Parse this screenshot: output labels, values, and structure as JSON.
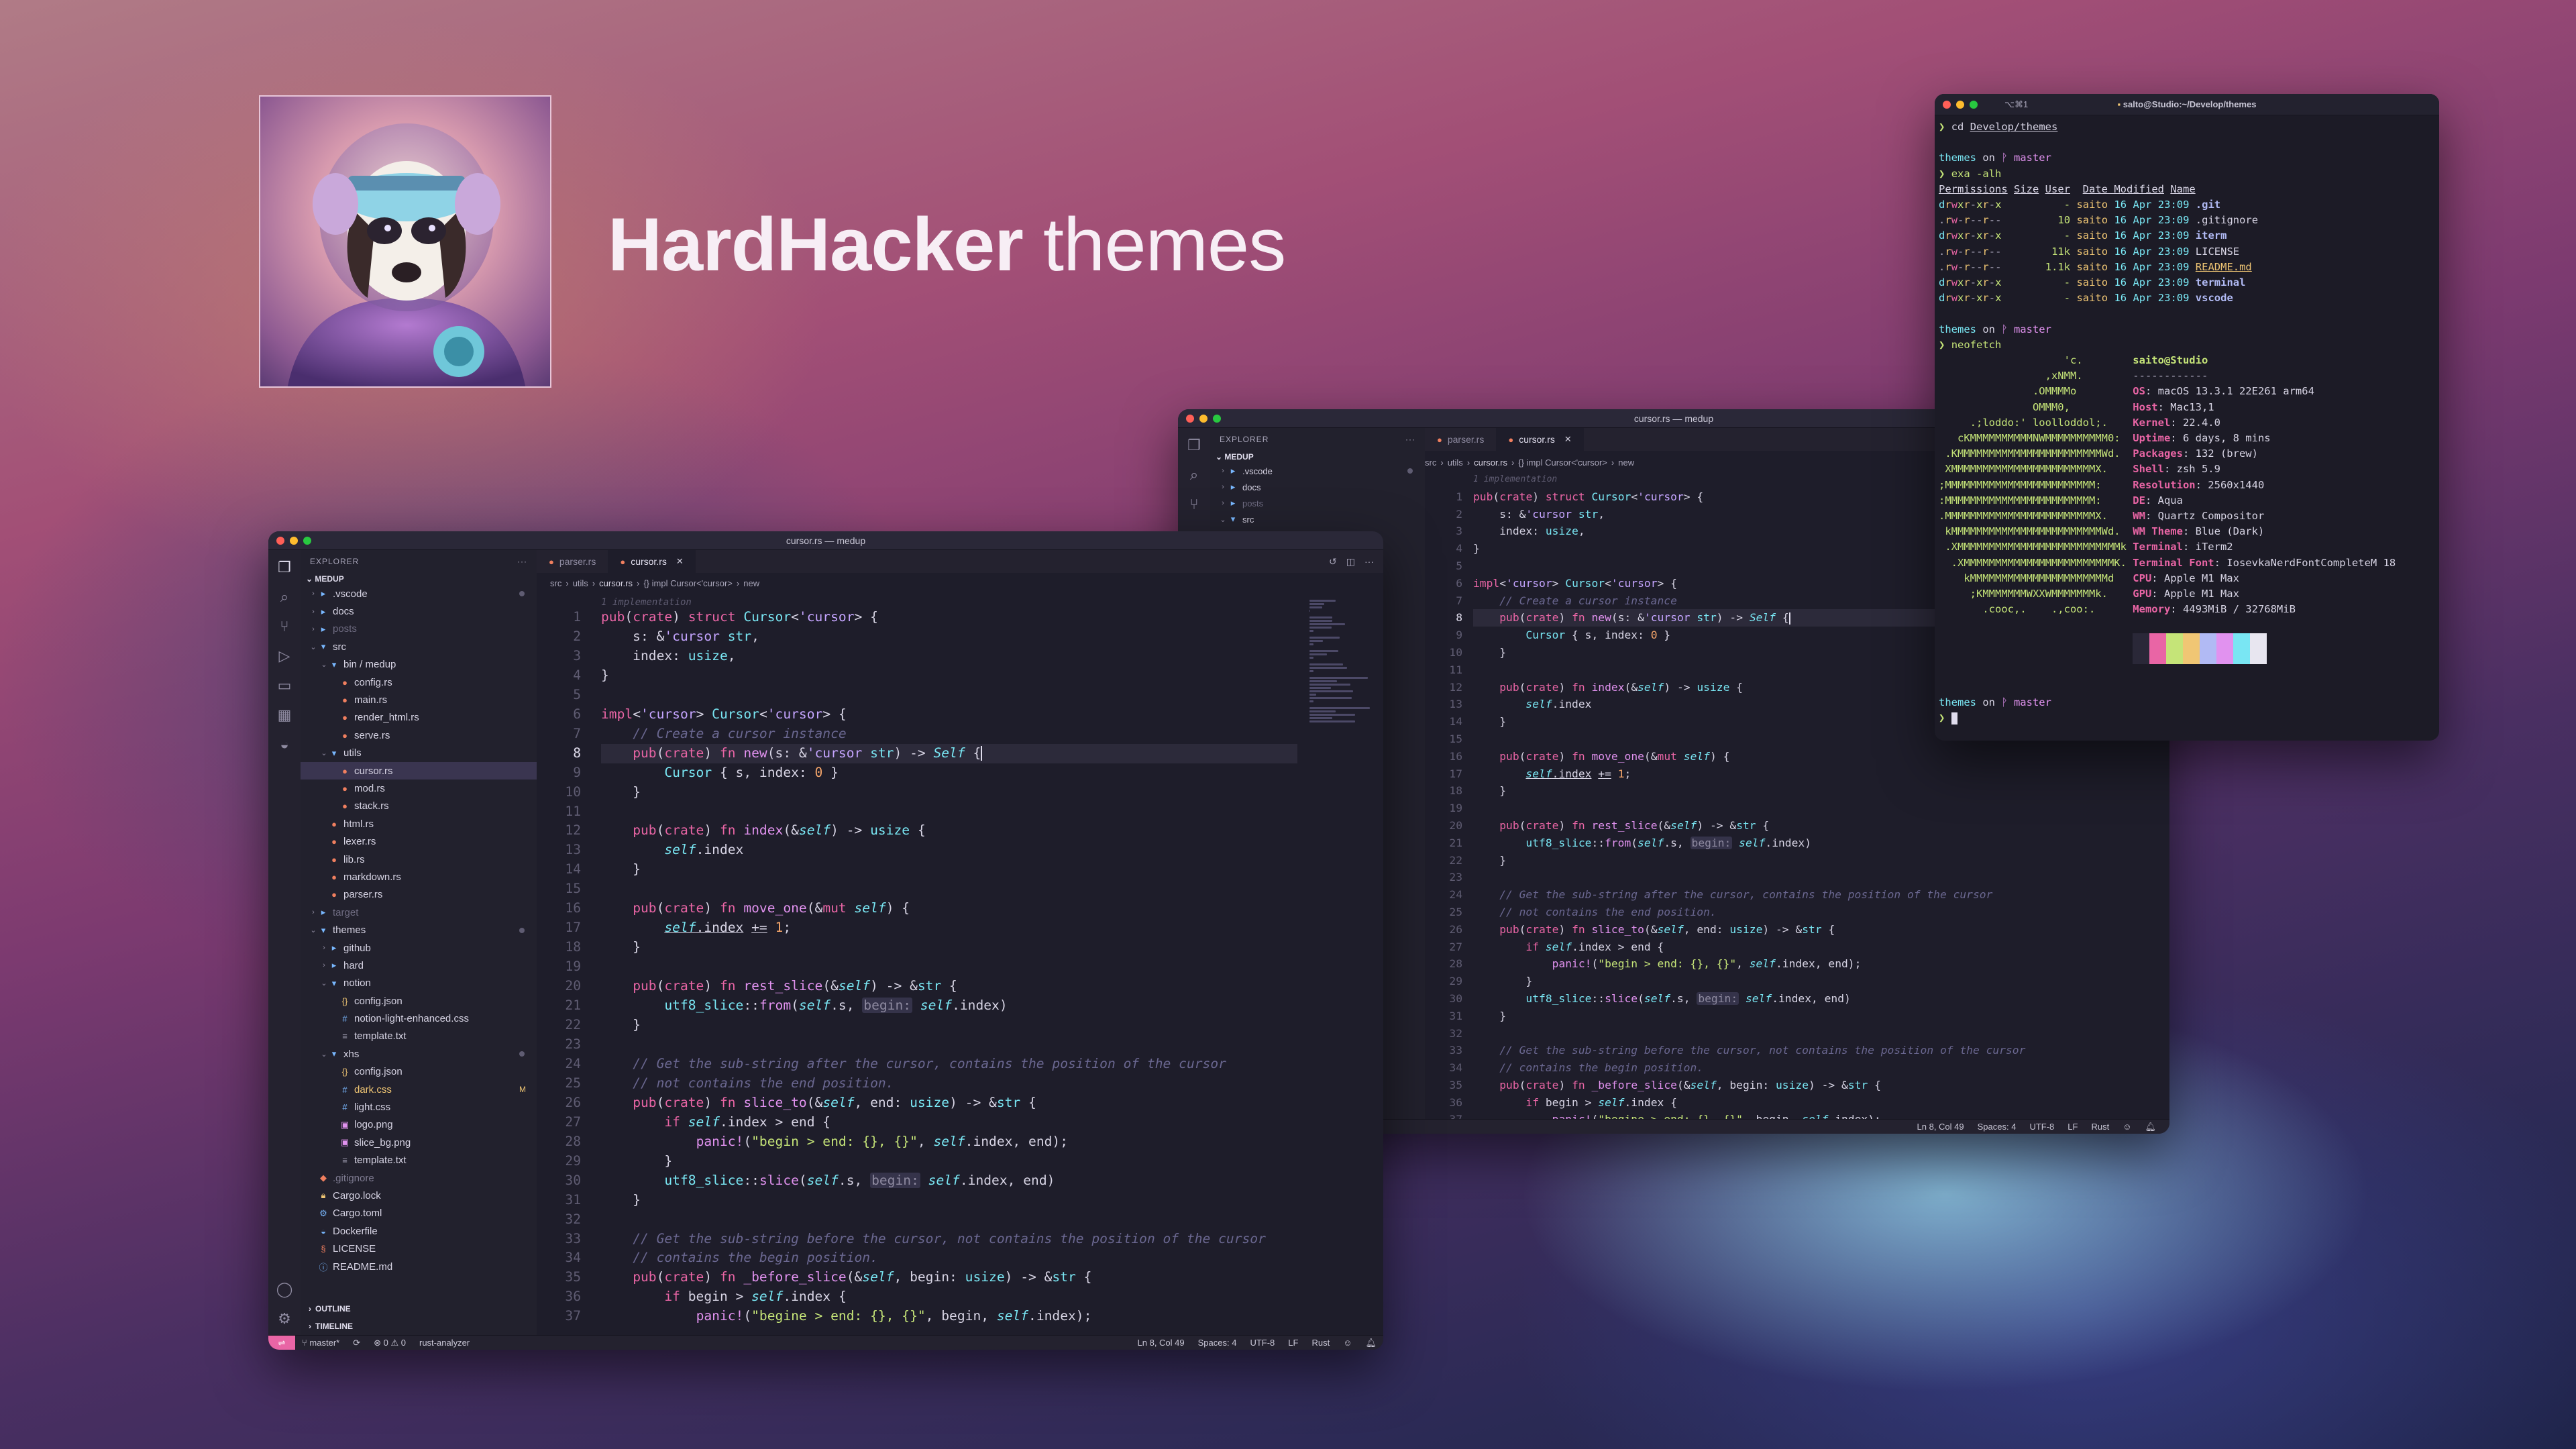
{
  "hero": {
    "title_bold": "HardHacker",
    "title_rest": " themes"
  },
  "editor_main": {
    "window_title": "cursor.rs — medup",
    "explorer_label": "EXPLORER",
    "root_label": "MEDUP",
    "tree": [
      {
        "depth": 0,
        "type": "folder",
        "open": false,
        "name": ".vscode",
        "badge": "dot"
      },
      {
        "depth": 0,
        "type": "folder",
        "open": false,
        "name": "docs"
      },
      {
        "depth": 0,
        "type": "folder",
        "open": false,
        "name": "posts",
        "dim": true
      },
      {
        "depth": 0,
        "type": "folder",
        "open": true,
        "name": "src"
      },
      {
        "depth": 1,
        "type": "folder",
        "open": true,
        "name": "bin / medup"
      },
      {
        "depth": 2,
        "type": "rust",
        "name": "config.rs"
      },
      {
        "depth": 2,
        "type": "rust",
        "name": "main.rs"
      },
      {
        "depth": 2,
        "type": "rust",
        "name": "render_html.rs"
      },
      {
        "depth": 2,
        "type": "rust",
        "name": "serve.rs"
      },
      {
        "depth": 1,
        "type": "folder",
        "open": true,
        "name": "utils"
      },
      {
        "depth": 2,
        "type": "rust",
        "name": "cursor.rs",
        "selected": true
      },
      {
        "depth": 2,
        "type": "rust",
        "name": "mod.rs"
      },
      {
        "depth": 2,
        "type": "rust",
        "name": "stack.rs"
      },
      {
        "depth": 1,
        "type": "rust",
        "name": "html.rs"
      },
      {
        "depth": 1,
        "type": "rust",
        "name": "lexer.rs"
      },
      {
        "depth": 1,
        "type": "rust",
        "name": "lib.rs"
      },
      {
        "depth": 1,
        "type": "rust",
        "name": "markdown.rs"
      },
      {
        "depth": 1,
        "type": "rust",
        "name": "parser.rs"
      },
      {
        "depth": 0,
        "type": "folder",
        "open": false,
        "name": "target",
        "dim": true
      },
      {
        "depth": 0,
        "type": "folder",
        "open": true,
        "name": "themes",
        "badge": "dot"
      },
      {
        "depth": 1,
        "type": "folder",
        "open": false,
        "name": "github"
      },
      {
        "depth": 1,
        "type": "folder",
        "open": false,
        "name": "hard"
      },
      {
        "depth": 1,
        "type": "folder",
        "open": true,
        "name": "notion"
      },
      {
        "depth": 2,
        "type": "json",
        "name": "config.json"
      },
      {
        "depth": 2,
        "type": "css",
        "name": "notion-light-enhanced.css"
      },
      {
        "depth": 2,
        "type": "txt",
        "name": "template.txt"
      },
      {
        "depth": 1,
        "type": "folder",
        "open": true,
        "name": "xhs",
        "badge": "dot"
      },
      {
        "depth": 2,
        "type": "json",
        "name": "config.json"
      },
      {
        "depth": 2,
        "type": "css",
        "name": "dark.css",
        "modified": true,
        "badge": "M"
      },
      {
        "depth": 2,
        "type": "css",
        "name": "light.css"
      },
      {
        "depth": 2,
        "type": "img",
        "name": "logo.png"
      },
      {
        "depth": 2,
        "type": "img",
        "name": "slice_bg.png"
      },
      {
        "depth": 2,
        "type": "txt",
        "name": "template.txt"
      },
      {
        "depth": 0,
        "type": "git",
        "name": ".gitignore",
        "ign": true
      },
      {
        "depth": 0,
        "type": "lock",
        "name": "Cargo.lock"
      },
      {
        "depth": 0,
        "type": "toml",
        "name": "Cargo.toml"
      },
      {
        "depth": 0,
        "type": "docker",
        "name": "Dockerfile"
      },
      {
        "depth": 0,
        "type": "lic",
        "name": "LICENSE"
      },
      {
        "depth": 0,
        "type": "md",
        "name": "README.md"
      }
    ],
    "outline_label": "OUTLINE",
    "timeline_label": "TIMELINE",
    "tabs": [
      {
        "name": "parser.rs",
        "active": false
      },
      {
        "name": "cursor.rs",
        "active": true
      }
    ],
    "breadcrumb": [
      "src",
      "utils",
      "cursor.rs",
      "{} impl Cursor<'cursor>",
      "new"
    ],
    "status": {
      "branch": "master*",
      "problems": "0 ⚠ 0",
      "lsp": "rust-analyzer",
      "position": "Ln 8, Col 49",
      "spaces": "Spaces: 4",
      "encoding": "UTF-8",
      "eol": "LF",
      "language": "Rust"
    }
  },
  "editor_back": {
    "window_title": "cursor.rs — medup",
    "explorer_label": "EXPLORER",
    "root_label": "MEDUP",
    "tree": [
      {
        "depth": 0,
        "type": "folder",
        "open": false,
        "name": ".vscode",
        "badge": "dot"
      },
      {
        "depth": 0,
        "type": "folder",
        "open": false,
        "name": "docs"
      },
      {
        "depth": 0,
        "type": "folder",
        "open": false,
        "name": "posts",
        "dim": true
      },
      {
        "depth": 0,
        "type": "folder",
        "open": true,
        "name": "src"
      }
    ],
    "tabs": [
      {
        "name": "parser.rs",
        "active": false
      },
      {
        "name": "cursor.rs",
        "active": true
      }
    ],
    "breadcrumb": [
      "src",
      "utils",
      "cursor.rs",
      "{} impl Cursor<'cursor>",
      "new"
    ],
    "status": {
      "position": "Ln 8, Col 49",
      "spaces": "Spaces: 4",
      "encoding": "UTF-8",
      "eol": "LF",
      "language": "Rust"
    }
  },
  "code": {
    "hint": "1 implementation",
    "current_line": 8,
    "lines": [
      "<span class=k>pub</span>(<span class=k>crate</span>) <span class=k>struct</span> <span class=t>Cursor</span>&lt;<span class=lt>'cursor</span>&gt; {",
      "    s: &amp;<span class=lt>'cursor</span> <span class=t>str</span>,",
      "    index: <span class=t>usize</span>,",
      "}",
      "",
      "<span class=k>impl</span>&lt;<span class=lt>'cursor</span>&gt; <span class=t>Cursor</span>&lt;<span class=lt>'cursor</span>&gt; {",
      "    <span class=c>// Create a cursor instance</span>",
      "    <span class=k>pub</span>(<span class=k>crate</span>) <span class=k>fn</span> <span class=f>new</span>(s: &amp;<span class=lt>'cursor</span> <span class=t>str</span>) -&gt; <span class=sf>Self</span> {<span class=caret></span>",
      "        <span class=t>Cursor</span> { s, index: <span class=n>0</span> }",
      "    }",
      "",
      "    <span class=k>pub</span>(<span class=k>crate</span>) <span class=k>fn</span> <span class=f>index</span>(&amp;<span class=sf>self</span>) -&gt; <span class=t>usize</span> {",
      "        <span class=sf>self</span>.index",
      "    }",
      "",
      "    <span class=k>pub</span>(<span class=k>crate</span>) <span class=k>fn</span> <span class=f u>move_one</span>(&amp;<span class=k>mut</span> <span class=sf u>self</span>) {",
      "        <span class=u><span class=sf>self</span>.index</span> <span class=u>+=</span> <span class=n>1</span>;",
      "    }",
      "",
      "    <span class=k>pub</span>(<span class=k>crate</span>) <span class=k>fn</span> <span class=f>rest_slice</span>(&amp;<span class=sf>self</span>) -&gt; &amp;<span class=t>str</span> {",
      "        <span class=t>utf8_slice</span>::<span class=f>from</span>(<span class=sf>self</span>.s, <span class=ih>begin:</span> <span class=sf>self</span>.index)",
      "    }",
      "",
      "    <span class=c>// Get the sub-string after the cursor, contains the position of the cursor</span>",
      "    <span class=c>// not contains the end position.</span>",
      "    <span class=k>pub</span>(<span class=k>crate</span>) <span class=k>fn</span> <span class=f>slice_to</span>(&amp;<span class=sf>self</span>, end: <span class=t>usize</span>) -&gt; &amp;<span class=t>str</span> {",
      "        <span class=k>if</span> <span class=sf>self</span>.index &gt; end {",
      "            <span class=f>panic!</span>(<span class=s>\"begin &gt; end: {}, {}\"</span>, <span class=sf>self</span>.index, end);",
      "        }",
      "        <span class=t>utf8_slice</span>::<span class=f>slice</span>(<span class=sf>self</span>.s, <span class=ih>begin:</span> <span class=sf>self</span>.index, end)",
      "    }",
      "",
      "    <span class=c>// Get the sub-string before the cursor, not contains the position of the cursor</span>",
      "    <span class=c>// contains the begin position.</span>",
      "    <span class=k>pub</span>(<span class=k>crate</span>) <span class=k>fn</span> <span class=f>_before_slice</span>(&amp;<span class=sf>self</span>, begin: <span class=t>usize</span>) -&gt; &amp;<span class=t>str</span> {",
      "        <span class=k>if</span> begin &gt; <span class=sf>self</span>.index {",
      "            <span class=f>panic!</span>(<span class=s>\"begine &gt; end: {}, {}\"</span>, begin, <span class=sf>self</span>.index);"
    ]
  },
  "terminal": {
    "tab_label": "⌥⌘1",
    "window_title": "salto@Studio:~/Develop/themes",
    "cmd1": "cd Develop/themes",
    "prompt_dir": "themes",
    "prompt_on": " on ",
    "prompt_branch": "ᚹ master",
    "cmd2": "exa -alh",
    "ls_header": [
      "Permissions",
      "Size",
      "User",
      "Date Modified",
      "Name"
    ],
    "ls_rows": [
      [
        "drwxr-xr-x",
        "-",
        "saito",
        "16 Apr 23:09",
        ".git"
      ],
      [
        ".rw-r--r--",
        "10",
        "saito",
        "16 Apr 23:09",
        ".gitignore"
      ],
      [
        "drwxr-xr-x",
        "-",
        "saito",
        "16 Apr 23:09",
        "iterm"
      ],
      [
        ".rw-r--r--",
        "11k",
        "saito",
        "16 Apr 23:09",
        "LICENSE"
      ],
      [
        ".rw-r--r--",
        "1.1k",
        "saito",
        "16 Apr 23:09",
        "README.md"
      ],
      [
        "drwxr-xr-x",
        "-",
        "saito",
        "16 Apr 23:09",
        "terminal"
      ],
      [
        "drwxr-xr-x",
        "-",
        "saito",
        "16 Apr 23:09",
        "vscode"
      ]
    ],
    "cmd3": "neofetch",
    "neofetch_logo": [
      "                    'c.",
      "                 ,xNMM.",
      "               .OMMMMo",
      "               OMMM0,",
      "     .;loddo:' loolloddol;.",
      "   cKMMMMMMMMMMNWMMMMMMMMMM0:",
      " .KMMMMMMMMMMMMMMMMMMMMMMMWd.",
      " XMMMMMMMMMMMMMMMMMMMMMMMX.",
      ";MMMMMMMMMMMMMMMMMMMMMMMM:",
      ":MMMMMMMMMMMMMMMMMMMMMMMM:",
      ".MMMMMMMMMMMMMMMMMMMMMMMMX.",
      " kMMMMMMMMMMMMMMMMMMMMMMMMWd.",
      " .XMMMMMMMMMMMMMMMMMMMMMMMMMMk",
      "  .XMMMMMMMMMMMMMMMMMMMMMMMMK.",
      "    kMMMMMMMMMMMMMMMMMMMMMMd",
      "     ;KMMMMMMMWXXWMMMMMMMk.",
      "       .cooc,.    .,coo:."
    ],
    "nf_user": "saito@Studio",
    "nf_sep": "------------",
    "nf_info": [
      [
        "OS",
        "macOS 13.3.1 22E261 arm64"
      ],
      [
        "Host",
        "Mac13,1"
      ],
      [
        "Kernel",
        "22.4.0"
      ],
      [
        "Uptime",
        "6 days, 8 mins"
      ],
      [
        "Packages",
        "132 (brew)"
      ],
      [
        "Shell",
        "zsh 5.9"
      ],
      [
        "Resolution",
        "2560x1440"
      ],
      [
        "DE",
        "Aqua"
      ],
      [
        "WM",
        "Quartz Compositor"
      ],
      [
        "WM Theme",
        "Blue (Dark)"
      ],
      [
        "Terminal",
        "iTerm2"
      ],
      [
        "Terminal Font",
        "IosevkaNerdFontCompleteM 18"
      ],
      [
        "CPU",
        "Apple M1 Max"
      ],
      [
        "GPU",
        "Apple M1 Max"
      ],
      [
        "Memory",
        "4493MiB / 32768MiB"
      ]
    ],
    "palette": [
      "#2a2838",
      "#e965a5",
      "#c5e478",
      "#f0c674",
      "#b1baf4",
      "#e192ef",
      "#79e6f3",
      "#e8e6f0"
    ]
  }
}
